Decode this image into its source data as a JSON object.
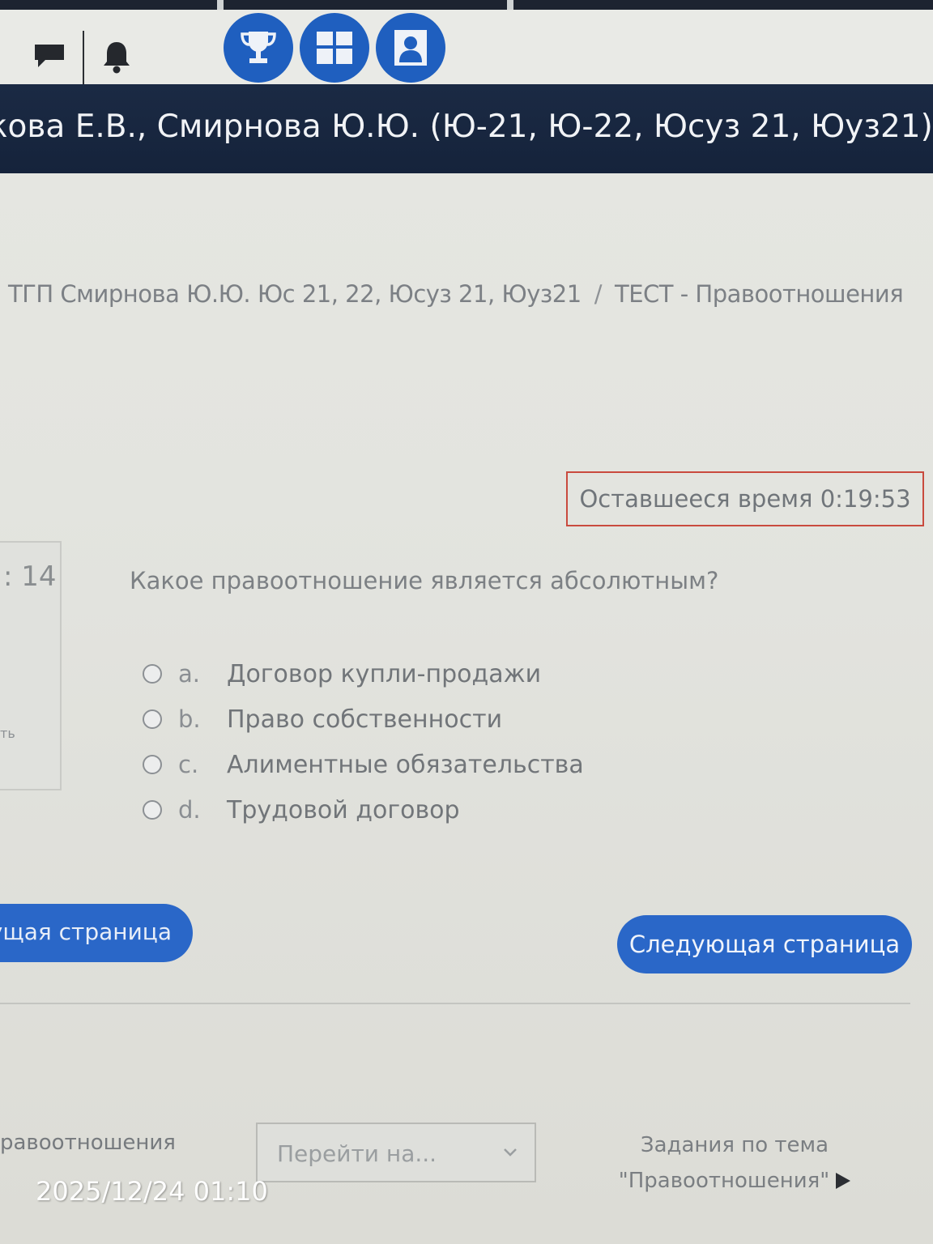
{
  "colors": {
    "accent_blue": "#1f5fbf",
    "button_blue": "#2a67c8",
    "header_navy": "#1b2a44",
    "timer_border": "#c94a3e"
  },
  "topbar": {
    "icons": [
      "chat-icon",
      "bell-icon",
      "trophy-icon",
      "grid-icon",
      "profile-icon"
    ]
  },
  "course": {
    "title": "кова Е.В., Смирнова Ю.Ю. (Ю-21, Ю-22, Юсуз 21, Юуз21)"
  },
  "breadcrumb": {
    "items": [
      "ТГП Смирнова Ю.Ю. Юс 21, 22, Юсуз 21, Юуз21",
      "ТЕСТ - Правоотношения"
    ],
    "separator": "/"
  },
  "timer": {
    "label": "Оставшееся время 0:19:53"
  },
  "question_info": {
    "number": ": 14",
    "link_fragment": "ть"
  },
  "question": {
    "text": "Какое правоотношение является абсолютным?",
    "options": [
      {
        "letter": "a.",
        "text": "Договор купли-продажи"
      },
      {
        "letter": "b.",
        "text": "Право собственности"
      },
      {
        "letter": "c.",
        "text": "Алиментные обязательства"
      },
      {
        "letter": "d.",
        "text": "Трудовой договор"
      }
    ]
  },
  "nav": {
    "prev_label": "дущая страница",
    "next_label": "Следующая страница"
  },
  "footer": {
    "prev_link": "равоотношения",
    "jump_placeholder": "Перейти на...",
    "next_link_line1": "Задания по тема",
    "next_link_line2": "\"Правоотношения\""
  },
  "photo_timestamp": "2025/12/24 01:10"
}
